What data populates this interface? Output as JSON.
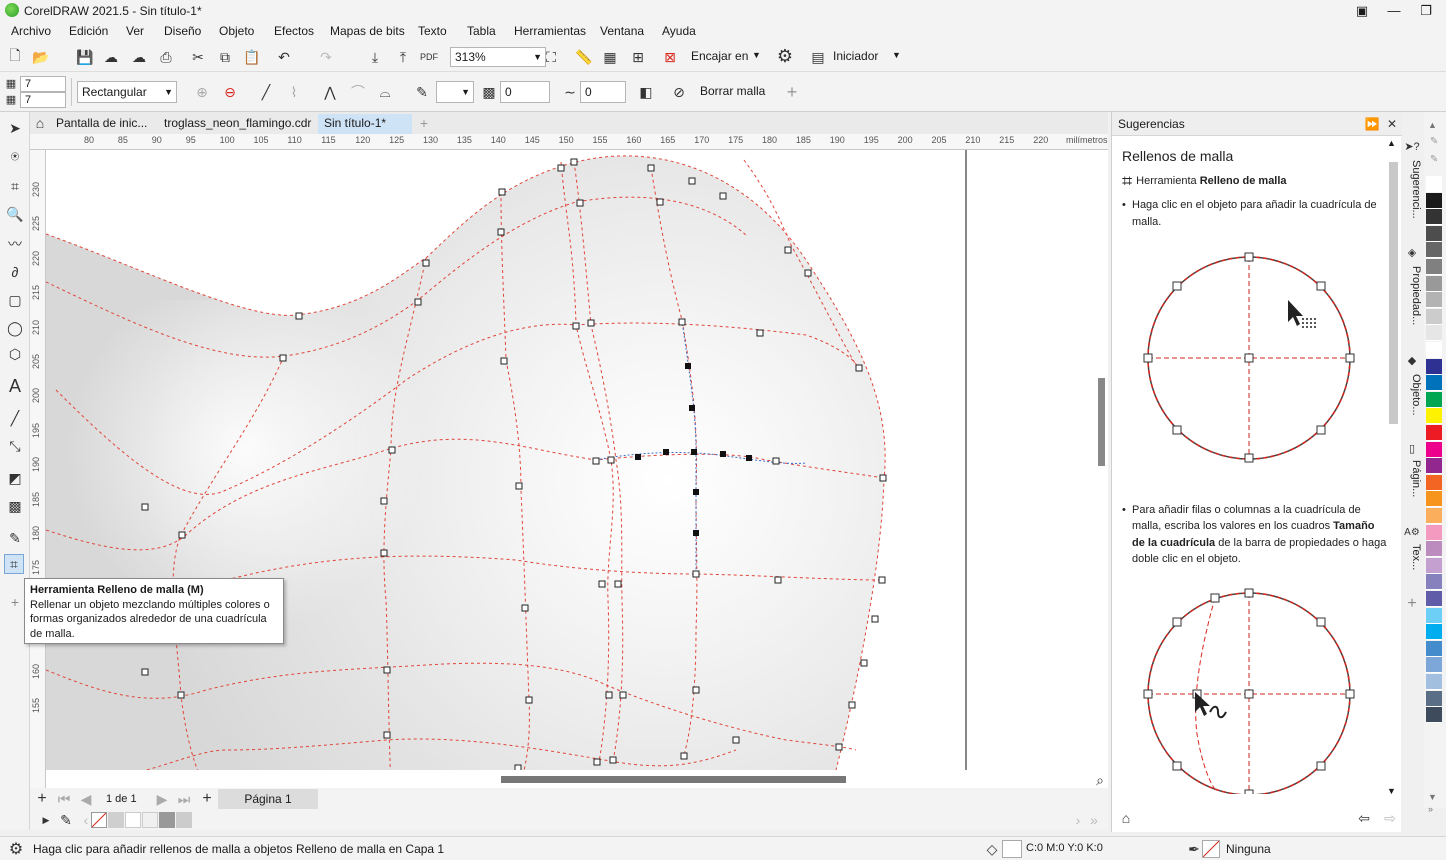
{
  "window": {
    "title": "CorelDRAW 2021.5 - Sin título-1*"
  },
  "menu": [
    "Archivo",
    "Edición",
    "Ver",
    "Diseño",
    "Objeto",
    "Efectos",
    "Mapas de bits",
    "Texto",
    "Tabla",
    "Herramientas",
    "Ventana",
    "Ayuda"
  ],
  "standard_toolbar": {
    "zoom": "313%",
    "snap_label": "Encajar en",
    "workspace_label": "Iniciador"
  },
  "property_bar": {
    "rows": "7",
    "cols": "7",
    "selection_mode": "Rectangular",
    "transparency_value": "0",
    "smoothing_value": "0",
    "clear_mesh_label": "Borrar malla"
  },
  "doc_tabs": [
    {
      "label": "Pantalla de inic..."
    },
    {
      "label": "troglass_neon_flamingo.cdr"
    },
    {
      "label": "Sin título-1*",
      "active": true
    }
  ],
  "ruler": {
    "unit": "milímetros",
    "top_ticks": [
      "80",
      "85",
      "90",
      "95",
      "100",
      "105",
      "110",
      "115",
      "120",
      "125",
      "130",
      "135",
      "140",
      "145",
      "150",
      "155",
      "160",
      "165",
      "170",
      "175",
      "180",
      "185",
      "190",
      "195",
      "200",
      "205",
      "210",
      "215",
      "220"
    ],
    "left_ticks": [
      "230",
      "225",
      "220",
      "215",
      "210",
      "205",
      "200",
      "195",
      "190",
      "185",
      "180",
      "175",
      "170",
      "165",
      "160",
      "155"
    ]
  },
  "tooltip": {
    "title": "Herramienta Relleno de malla (M)",
    "body": "Rellenar un objeto mezclando múltiples colores o formas organizados alrededor de una cuadrícula de malla."
  },
  "page_nav": {
    "counter": "1 de 1",
    "page_tab": "Página 1"
  },
  "status": {
    "hint": "Haga clic para añadir rellenos de malla a objetos",
    "object_info": "Relleno de malla en Capa 1",
    "fill_color": "C:0 M:0 Y:0 K:0",
    "outline": "Ninguna"
  },
  "docker": {
    "title": "Sugerencias",
    "heading": "Rellenos de malla",
    "tool_prefix": "Herramienta ",
    "tool_name": "Relleno de malla",
    "tip1": "Haga clic en el objeto para añadir la cuadrícula de malla.",
    "tip2_a": "Para añadir filas o columnas a la cuadrícula de malla, escriba los valores en los cuadros ",
    "tip2_b": "Tamaño de la cuadrícula",
    "tip2_c": " de la barra de propiedades o haga doble clic en el objeto."
  },
  "side_tabs": [
    "Sugerenci...",
    "Propiedad...",
    "Objeto...",
    "Págin...",
    "Tex..."
  ],
  "colors": {
    "accent_red": "#d9261c",
    "mesh_line": "#e0453a",
    "active_tab": "#cfe3f7"
  },
  "palette": [
    "#ffffff",
    "#1a1a1a",
    "#333333",
    "#4d4d4d",
    "#666666",
    "#808080",
    "#999999",
    "#b3b3b3",
    "#cccccc",
    "#e6e6e6",
    "#ffffff",
    "#2e3192",
    "#0072bc",
    "#00a651",
    "#fff200",
    "#ed1c24",
    "#ec008c",
    "#92278f",
    "#f26522",
    "#f7941d",
    "#fbaf5d",
    "#f49ac1",
    "#bd8cbf",
    "#c4a0d1",
    "#8781bd",
    "#605ca8",
    "#6dcff6",
    "#00aeef",
    "#448ccb",
    "#7da7d9",
    "#a3bfe0",
    "#5a6f85",
    "#3d4b5c"
  ]
}
